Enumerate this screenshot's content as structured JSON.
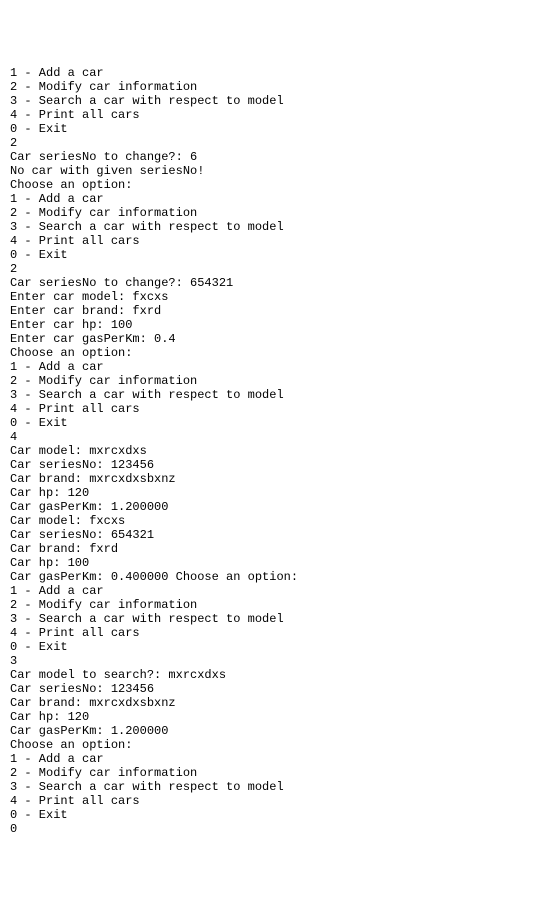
{
  "lines": [
    "1 - Add a car",
    "2 - Modify car information",
    "3 - Search a car with respect to model",
    "4 - Print all cars",
    "0 - Exit",
    "2",
    "Car seriesNo to change?: 6",
    "No car with given seriesNo!",
    "Choose an option:",
    "1 - Add a car",
    "2 - Modify car information",
    "3 - Search a car with respect to model",
    "4 - Print all cars",
    "0 - Exit",
    "2",
    "Car seriesNo to change?: 654321",
    "Enter car model: fxcxs",
    "Enter car brand: fxrd",
    "Enter car hp: 100",
    "Enter car gasPerKm: 0.4",
    "Choose an option:",
    "1 - Add a car",
    "2 - Modify car information",
    "3 - Search a car with respect to model",
    "4 - Print all cars",
    "0 - Exit",
    "4",
    "Car model: mxrcxdxs",
    "Car seriesNo: 123456",
    "Car brand: mxrcxdxsbxnz",
    "Car hp: 120",
    "Car gasPerKm: 1.200000",
    "Car model: fxcxs",
    "Car seriesNo: 654321",
    "Car brand: fxrd",
    "Car hp: 100",
    "Car gasPerKm: 0.400000 Choose an option:",
    "1 - Add a car",
    "2 - Modify car information",
    "3 - Search a car with respect to model",
    "4 - Print all cars",
    "0 - Exit",
    "3",
    "Car model to search?: mxrcxdxs",
    "Car seriesNo: 123456",
    "Car brand: mxrcxdxsbxnz",
    "Car hp: 120",
    "Car gasPerKm: 1.200000",
    "Choose an option:",
    "1 - Add a car",
    "2 - Modify car information",
    "3 - Search a car with respect to model",
    "4 - Print all cars",
    "0 - Exit",
    "0"
  ]
}
